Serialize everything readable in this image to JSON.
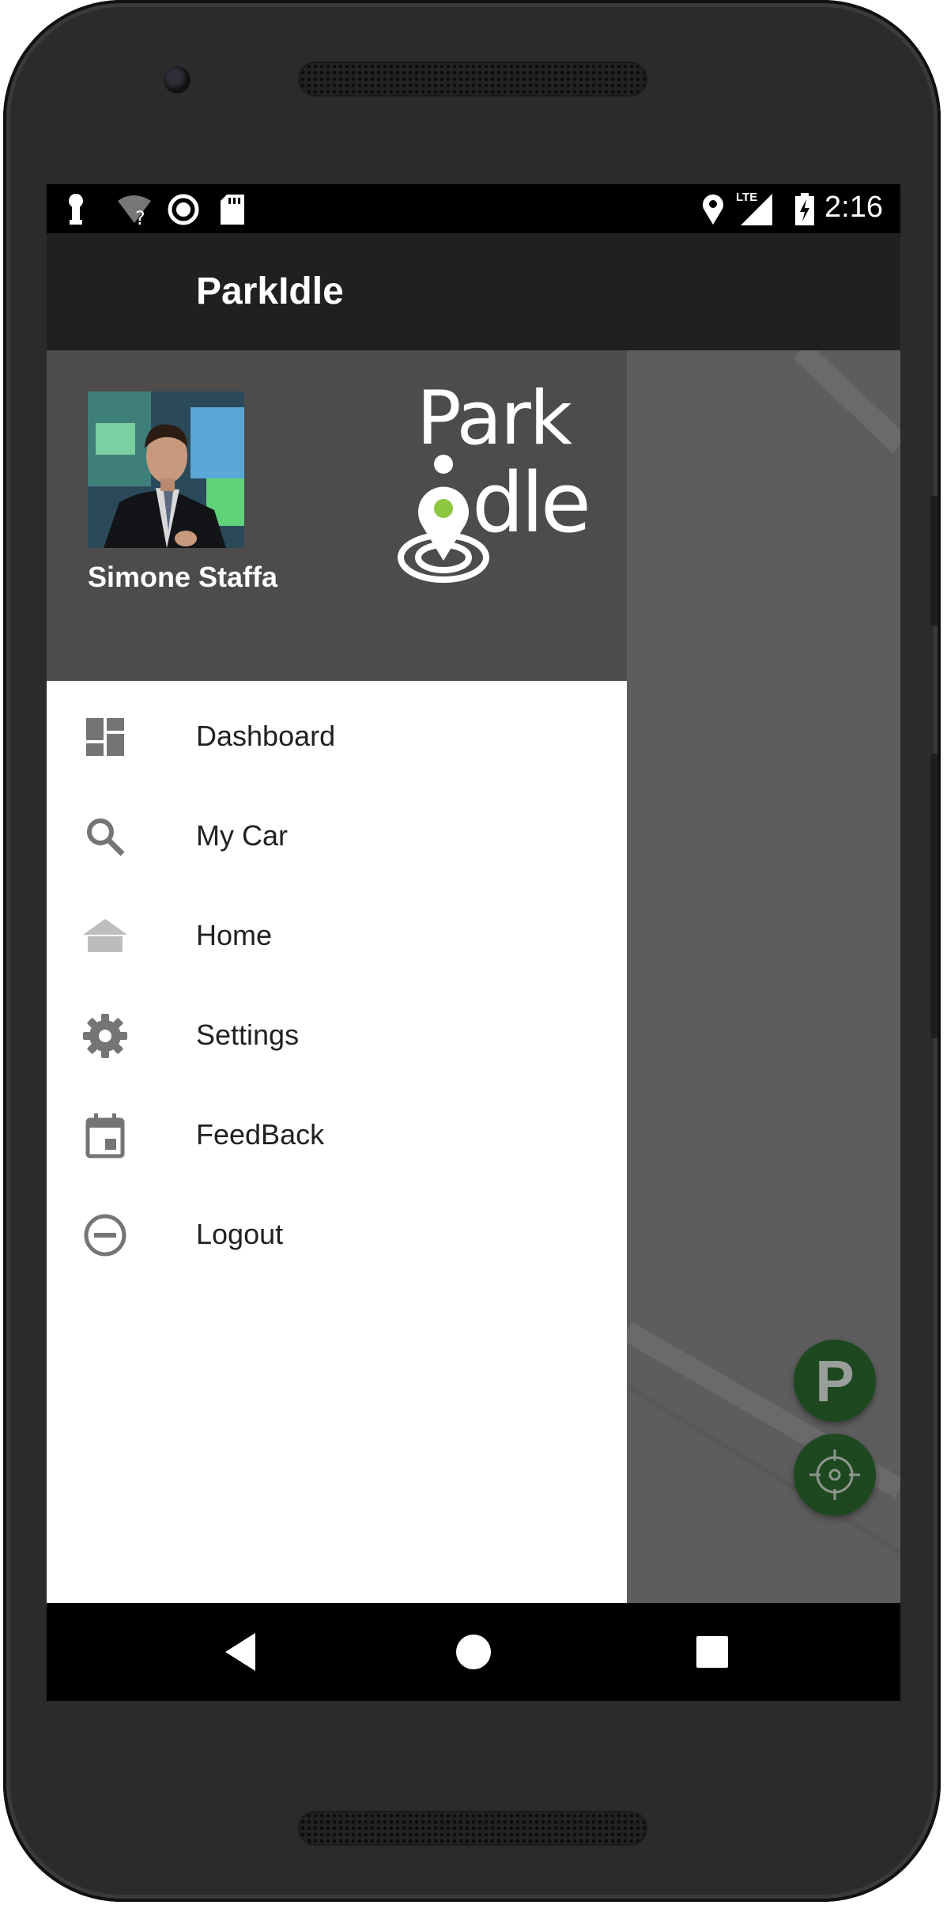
{
  "status_bar": {
    "time": "2:16",
    "network": "LTE",
    "icons": [
      "key-icon",
      "wifi-unknown-icon",
      "sync-circle-icon",
      "sd-card-icon",
      "location-icon",
      "lte-signal-icon",
      "battery-charging-icon"
    ]
  },
  "app_bar": {
    "title": "ParkIdle"
  },
  "drawer": {
    "user_name": "Simone Staffa",
    "logo_text_top": "Park",
    "logo_text_bottom": "dle",
    "items": [
      {
        "label": "Dashboard",
        "icon": "dashboard-icon"
      },
      {
        "label": "My Car",
        "icon": "search-icon"
      },
      {
        "label": "Home",
        "icon": "home-icon"
      },
      {
        "label": "Settings",
        "icon": "gear-icon"
      },
      {
        "label": "FeedBack",
        "icon": "calendar-icon"
      },
      {
        "label": "Logout",
        "icon": "minus-circle-icon"
      }
    ]
  },
  "fabs": {
    "parking_label": "P",
    "locate_icon": "crosshair-icon"
  },
  "nav_bar": {
    "icons": [
      "back-icon",
      "home-circle-icon",
      "recents-icon"
    ]
  },
  "colors": {
    "app_bar": "#221f20",
    "drawer_header": "#4e4b4c",
    "fab": "#1d4820",
    "logo_accent": "#8dc63f"
  }
}
